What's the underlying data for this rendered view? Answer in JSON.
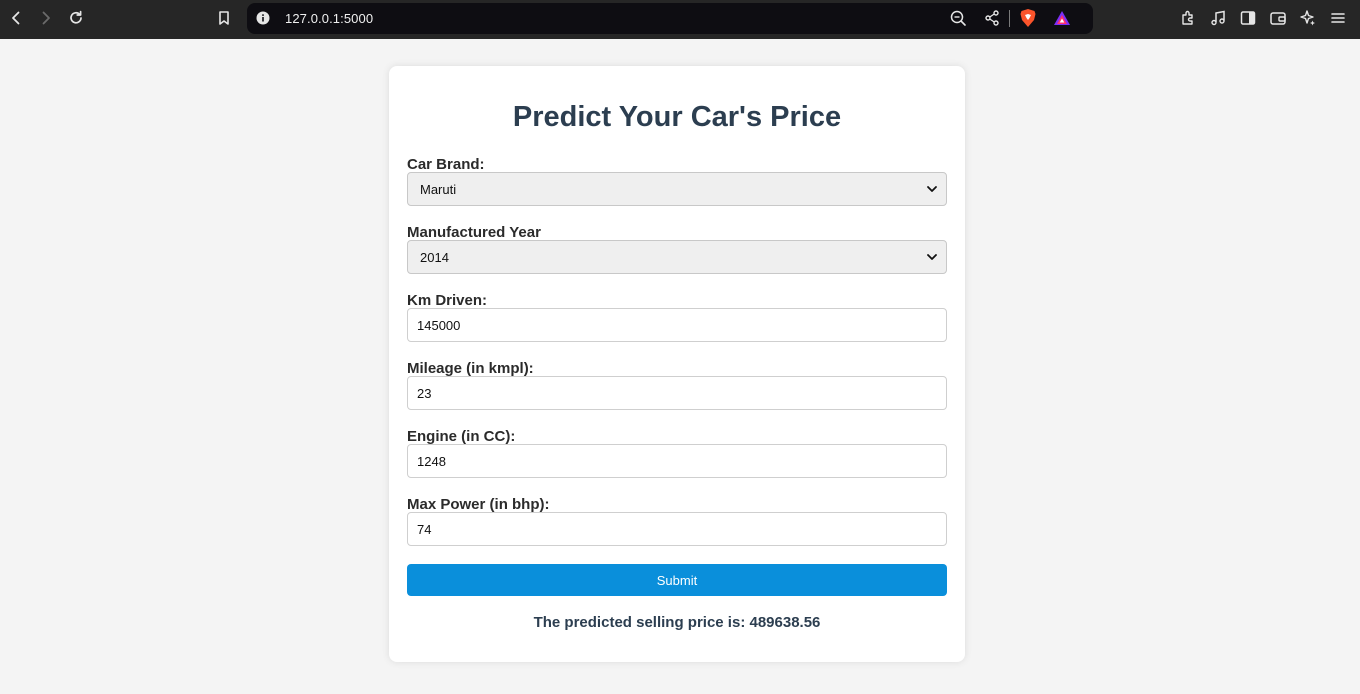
{
  "browser": {
    "url": "127.0.0.1:5000"
  },
  "page": {
    "title": "Predict Your Car's Price",
    "fields": {
      "brand_label": "Car Brand:",
      "brand_value": "Maruti",
      "year_label": "Manufactured Year",
      "year_value": "2014",
      "km_label": "Km Driven:",
      "km_value": "145000",
      "mileage_label": "Mileage (in kmpl):",
      "mileage_value": "23",
      "engine_label": "Engine (in CC):",
      "engine_value": "1248",
      "power_label": "Max Power (in bhp):",
      "power_value": "74"
    },
    "submit_label": "Submit",
    "result_text": "The predicted selling price is: 489638.56"
  },
  "colors": {
    "accent": "#0a8fdb",
    "heading": "#2c3e50",
    "chrome": "#262626",
    "page_bg": "#f4f4f4"
  },
  "icons": [
    "back-icon",
    "forward-icon",
    "reload-icon",
    "bookmark-icon",
    "site-info-icon",
    "zoom-icon",
    "share-icon",
    "brave-shields-icon",
    "brave-rewards-icon",
    "extensions-icon",
    "media-icon",
    "sidebar-icon",
    "wallet-icon",
    "leo-ai-icon",
    "menu-icon"
  ]
}
